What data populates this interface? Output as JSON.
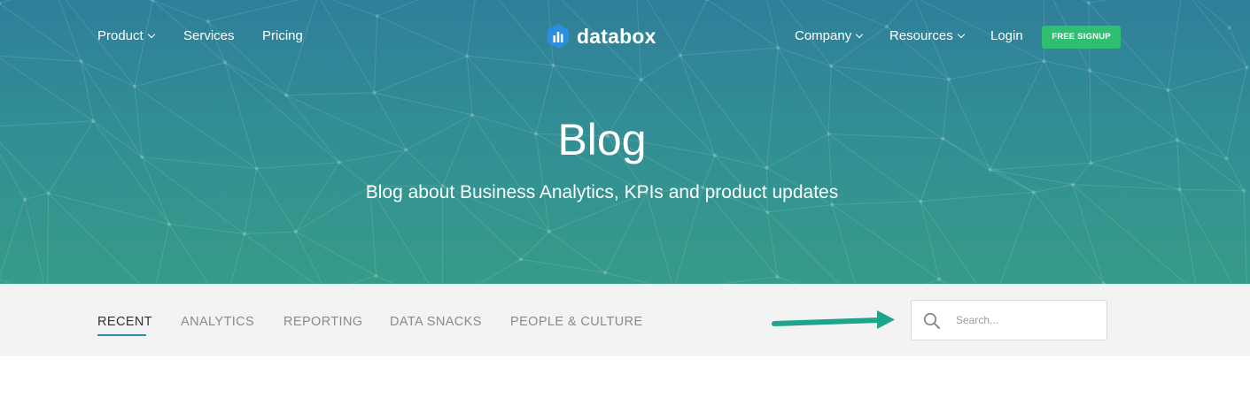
{
  "header": {
    "nav_left": [
      {
        "label": "Product",
        "dropdown": true
      },
      {
        "label": "Services",
        "dropdown": false
      },
      {
        "label": "Pricing",
        "dropdown": false
      }
    ],
    "logo_text": "databox",
    "nav_right": [
      {
        "label": "Company",
        "dropdown": true
      },
      {
        "label": "Resources",
        "dropdown": true
      },
      {
        "label": "Login",
        "dropdown": false
      }
    ],
    "signup_label": "FREE SIGNUP"
  },
  "hero": {
    "title": "Blog",
    "subtitle": "Blog about Business Analytics, KPIs and product updates"
  },
  "categories": {
    "items": [
      {
        "label": "RECENT",
        "active": true
      },
      {
        "label": "ANALYTICS",
        "active": false
      },
      {
        "label": "REPORTING",
        "active": false
      },
      {
        "label": "DATA SNACKS",
        "active": false
      },
      {
        "label": "PEOPLE & CULTURE",
        "active": false
      }
    ]
  },
  "search": {
    "placeholder": "Search...",
    "value": ""
  },
  "icons": {
    "search": "search-icon",
    "chevron": "chevron-down-icon",
    "logo": "databox-logo-icon",
    "annotation": "arrow-right-icon"
  },
  "colors": {
    "hero_top": "#2f7f9a",
    "hero_bottom": "#369b88",
    "signup_button": "#2fbf71",
    "category_active_underline": "#2e8fa8",
    "annotation_arrow": "#1ea58c",
    "category_bar": "#f3f3f3"
  }
}
